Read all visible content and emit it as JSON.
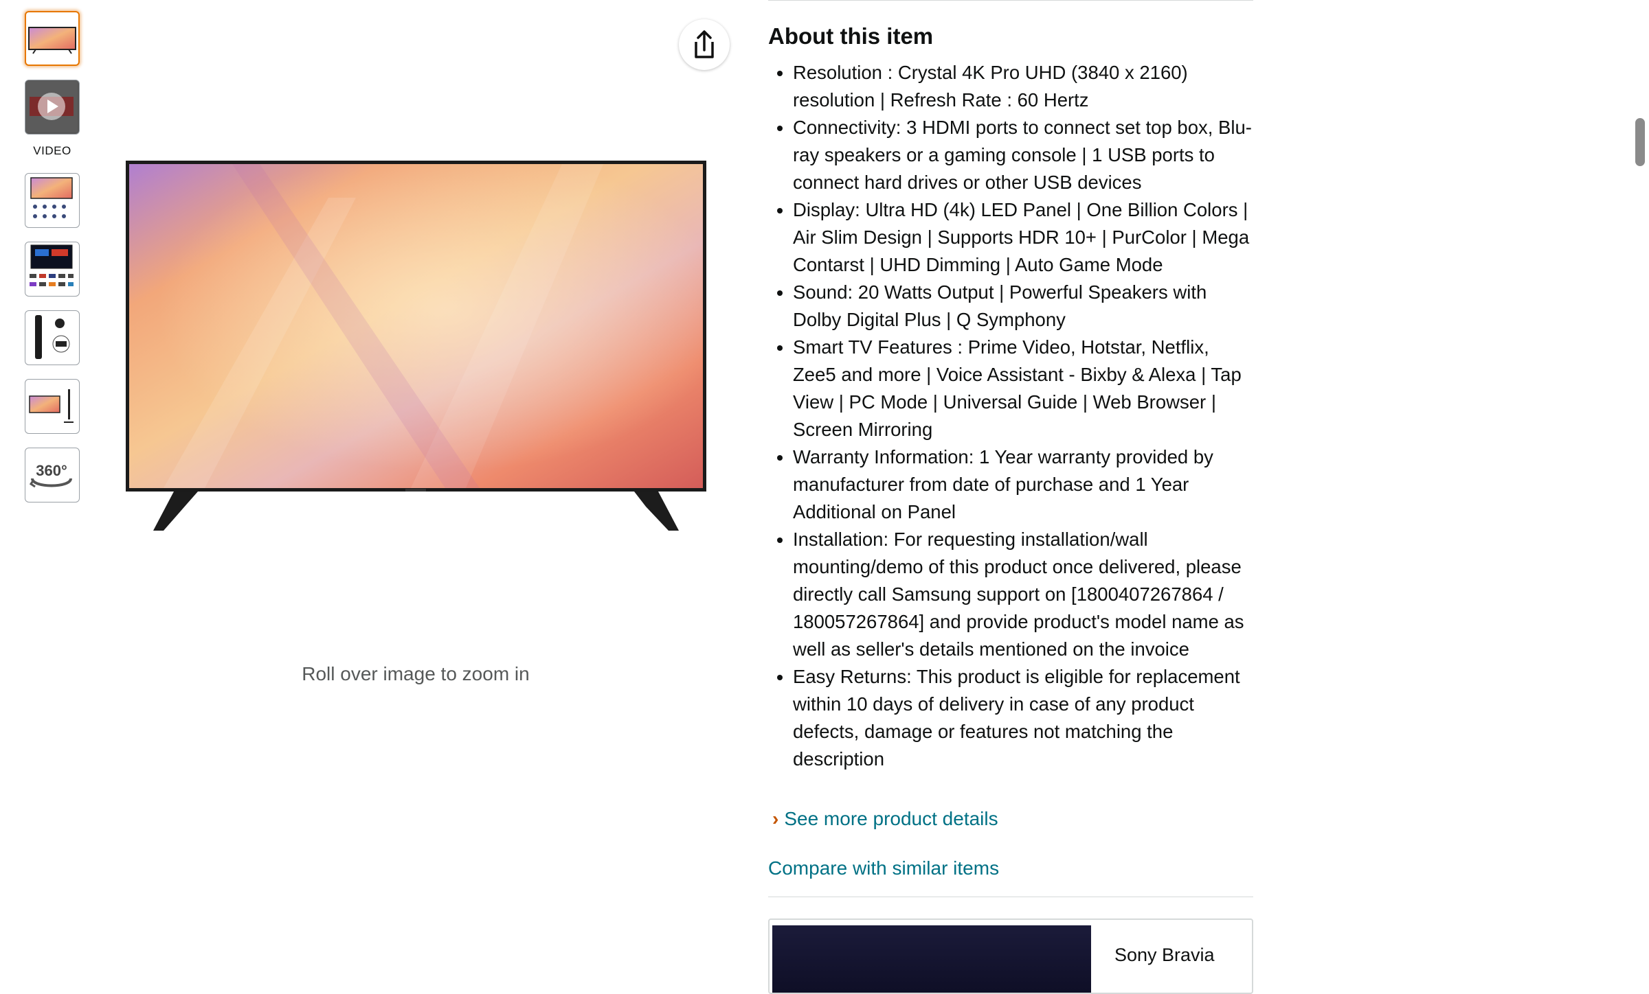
{
  "gallery": {
    "video_label": "VIDEO",
    "zoom_hint": "Roll over image to zoom in",
    "thumbnails": [
      "tv-front-thumbnail",
      "video-thumbnail",
      "infographic-thumbnail",
      "smart-hub-thumbnail",
      "remote-thumbnail",
      "tv-side-thumbnail",
      "360-view-thumbnail"
    ],
    "view360_label": "360°"
  },
  "about": {
    "title": "About this item",
    "bullets": [
      "Resolution : Crystal 4K Pro UHD (3840 x 2160) resolution | Refresh Rate : 60 Hertz",
      "Connectivity: 3 HDMI ports to connect set top box, Blu-ray speakers or a gaming console | 1 USB ports to connect hard drives or other USB devices",
      "Display: Ultra HD (4k) LED Panel | One Billion Colors | Air Slim Design | Supports HDR 10+ | PurColor | Mega Contarst | UHD Dimming | Auto Game Mode",
      "Sound: 20 Watts Output | Powerful Speakers with Dolby Digital Plus | Q Symphony",
      "Smart TV Features : Prime Video, Hotstar, Netflix, Zee5 and more | Voice Assistant - Bixby & Alexa | Tap View | PC Mode | Universal Guide | Web Browser | Screen Mirroring",
      "Warranty Information: 1 Year warranty provided by manufacturer from date of purchase and 1 Year Additional on Panel",
      "Installation: For requesting installation/wall mounting/demo of this product once delivered, please directly call Samsung support on [1800407267864 / 180057267864] and provide product's model name as well as seller's details mentioned on the invoice",
      "Easy Returns: This product is eligible for replacement within 10 days of delivery in case of any product defects, damage or features not matching the description"
    ],
    "see_more": "See more product details",
    "compare": "Compare with similar items"
  },
  "comparison_card": {
    "product_name": "Sony Bravia"
  },
  "colors": {
    "link": "#007185",
    "accent_orange": "#e77600",
    "text": "#0f1111"
  }
}
